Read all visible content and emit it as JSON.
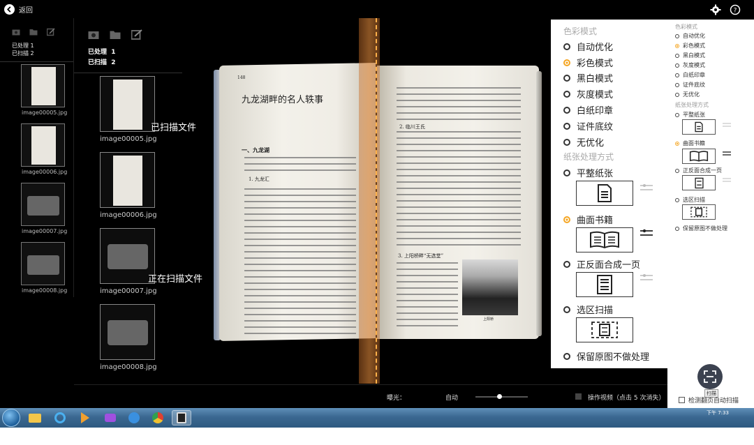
{
  "topbar": {
    "back_label": "返回"
  },
  "left1": {
    "processed_label": "已处理",
    "processed_count": "1",
    "scanned_label": "已扫描",
    "scanned_count": "2",
    "thumbs": [
      {
        "name": "image00005.jpg"
      },
      {
        "name": "image00006.jpg"
      },
      {
        "name": "image00007.jpg"
      },
      {
        "name": "image00008.jpg"
      }
    ]
  },
  "left2": {
    "processed_label": "已处理",
    "processed_count": "1",
    "scanned_label": "已扫描",
    "scanned_count": "2",
    "thumbs": [
      {
        "name": "image00005.jpg"
      },
      {
        "name": "image00006.jpg"
      },
      {
        "name": "image00007.jpg"
      },
      {
        "name": "image00008.jpg"
      }
    ],
    "scanned_files_overlay": "已扫描文件",
    "scanning_overlay": "正在扫描文件"
  },
  "book": {
    "left_page_number": "148",
    "left_title": "九龙湖畔的名人轶事",
    "left_section": "一、九龙湖",
    "left_sub": "1. 九龙汇",
    "right_sub1": "2. 临川王氏",
    "right_sub2": "3. 上阳桥畔“无选堂”",
    "photo_caption": "上阳桥"
  },
  "bottombar": {
    "exposure_label": "曝光：",
    "exposure_value": "自动",
    "exposure_level": 0.45,
    "video_label": "操作视频（点击 5 次消失）"
  },
  "options": {
    "color_mode_title": "色彩模式",
    "color_modes": [
      {
        "label": "自动优化",
        "selected": false
      },
      {
        "label": "彩色模式",
        "selected": true
      },
      {
        "label": "黑白模式",
        "selected": false
      },
      {
        "label": "灰度模式",
        "selected": false
      },
      {
        "label": "白纸印章",
        "selected": false
      },
      {
        "label": "证件底纹",
        "selected": false
      },
      {
        "label": "无优化",
        "selected": false
      }
    ],
    "paper_title": "纸张处理方式",
    "paper_modes": [
      {
        "label": "平整纸张",
        "selected": false,
        "icon": "flat-page-icon"
      },
      {
        "label": "曲面书籍",
        "selected": true,
        "icon": "open-book-icon"
      },
      {
        "label": "正反面合成一页",
        "selected": false,
        "icon": "duplex-page-icon"
      },
      {
        "label": "选区扫描",
        "selected": false,
        "icon": "area-select-icon"
      },
      {
        "label": "保留原图不做处理",
        "selected": false
      }
    ]
  },
  "options_small": {
    "color_mode_title": "色彩模式",
    "color_modes": [
      {
        "label": "自动优化",
        "selected": false
      },
      {
        "label": "彩色模式",
        "selected": true
      },
      {
        "label": "黑白模式",
        "selected": false
      },
      {
        "label": "灰度模式",
        "selected": false
      },
      {
        "label": "白纸印章",
        "selected": false
      },
      {
        "label": "证件底纹",
        "selected": false
      },
      {
        "label": "无优化",
        "selected": false
      }
    ],
    "paper_title": "纸张处理方式",
    "paper_modes": [
      {
        "label": "平整纸张",
        "selected": false
      },
      {
        "label": "曲面书籍",
        "selected": true
      },
      {
        "label": "正反面合成一页",
        "selected": false
      },
      {
        "label": "选区扫描",
        "selected": false
      },
      {
        "label": "保留原图不做处理",
        "selected": false
      }
    ],
    "scan_tooltip": "扫描",
    "detect_label": "检测翻页自动扫描"
  },
  "taskbar": {
    "time": "下午 7:33"
  },
  "colors": {
    "accent": "#f5a623",
    "panel_bg": "#ffffff",
    "app_bg": "#000000"
  }
}
